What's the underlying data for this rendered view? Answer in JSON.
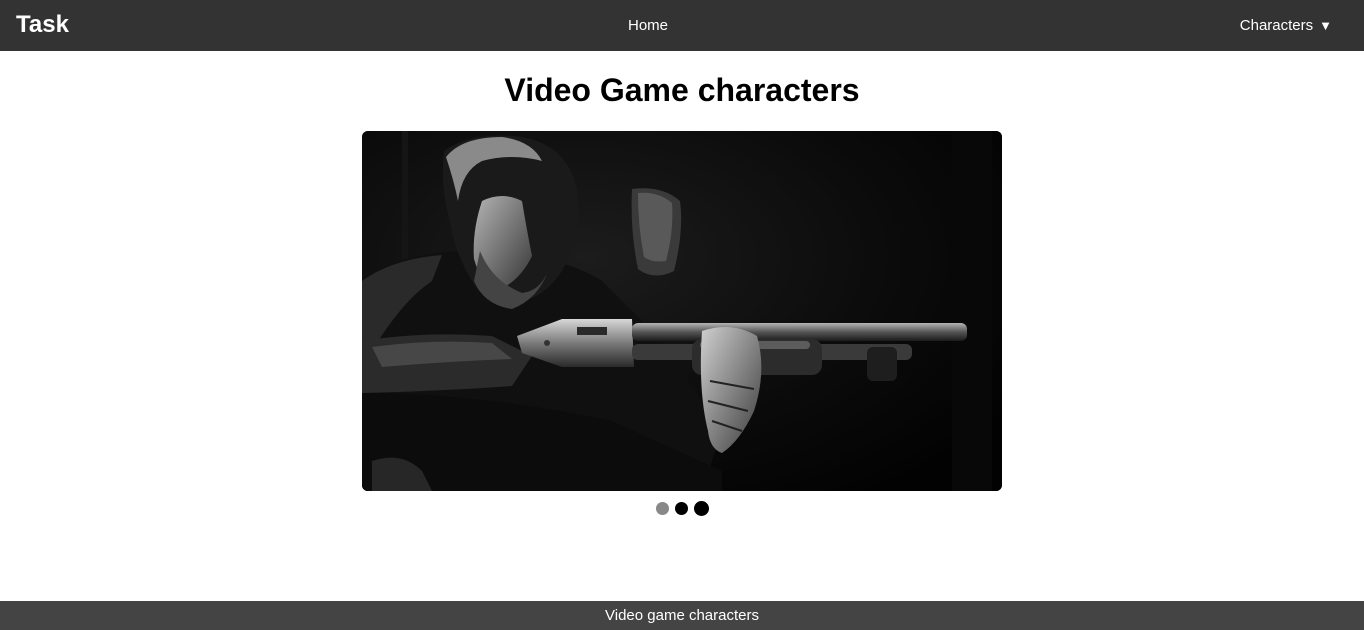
{
  "navbar": {
    "brand": "Task",
    "home_label": "Home",
    "characters_label": "Characters",
    "characters_caret": "▼"
  },
  "main": {
    "title": "Video Game characters",
    "carousel": {
      "slide_count": 3,
      "active_index": 0,
      "image_description": "black-and-white image of a bearded man aiming a pump-action shotgun"
    }
  },
  "footer": {
    "text": "Video game characters"
  },
  "colors": {
    "navbar_bg": "#333333",
    "footer_bg": "#444444",
    "dot_inactive": "#888888",
    "dot_active": "#000000"
  }
}
